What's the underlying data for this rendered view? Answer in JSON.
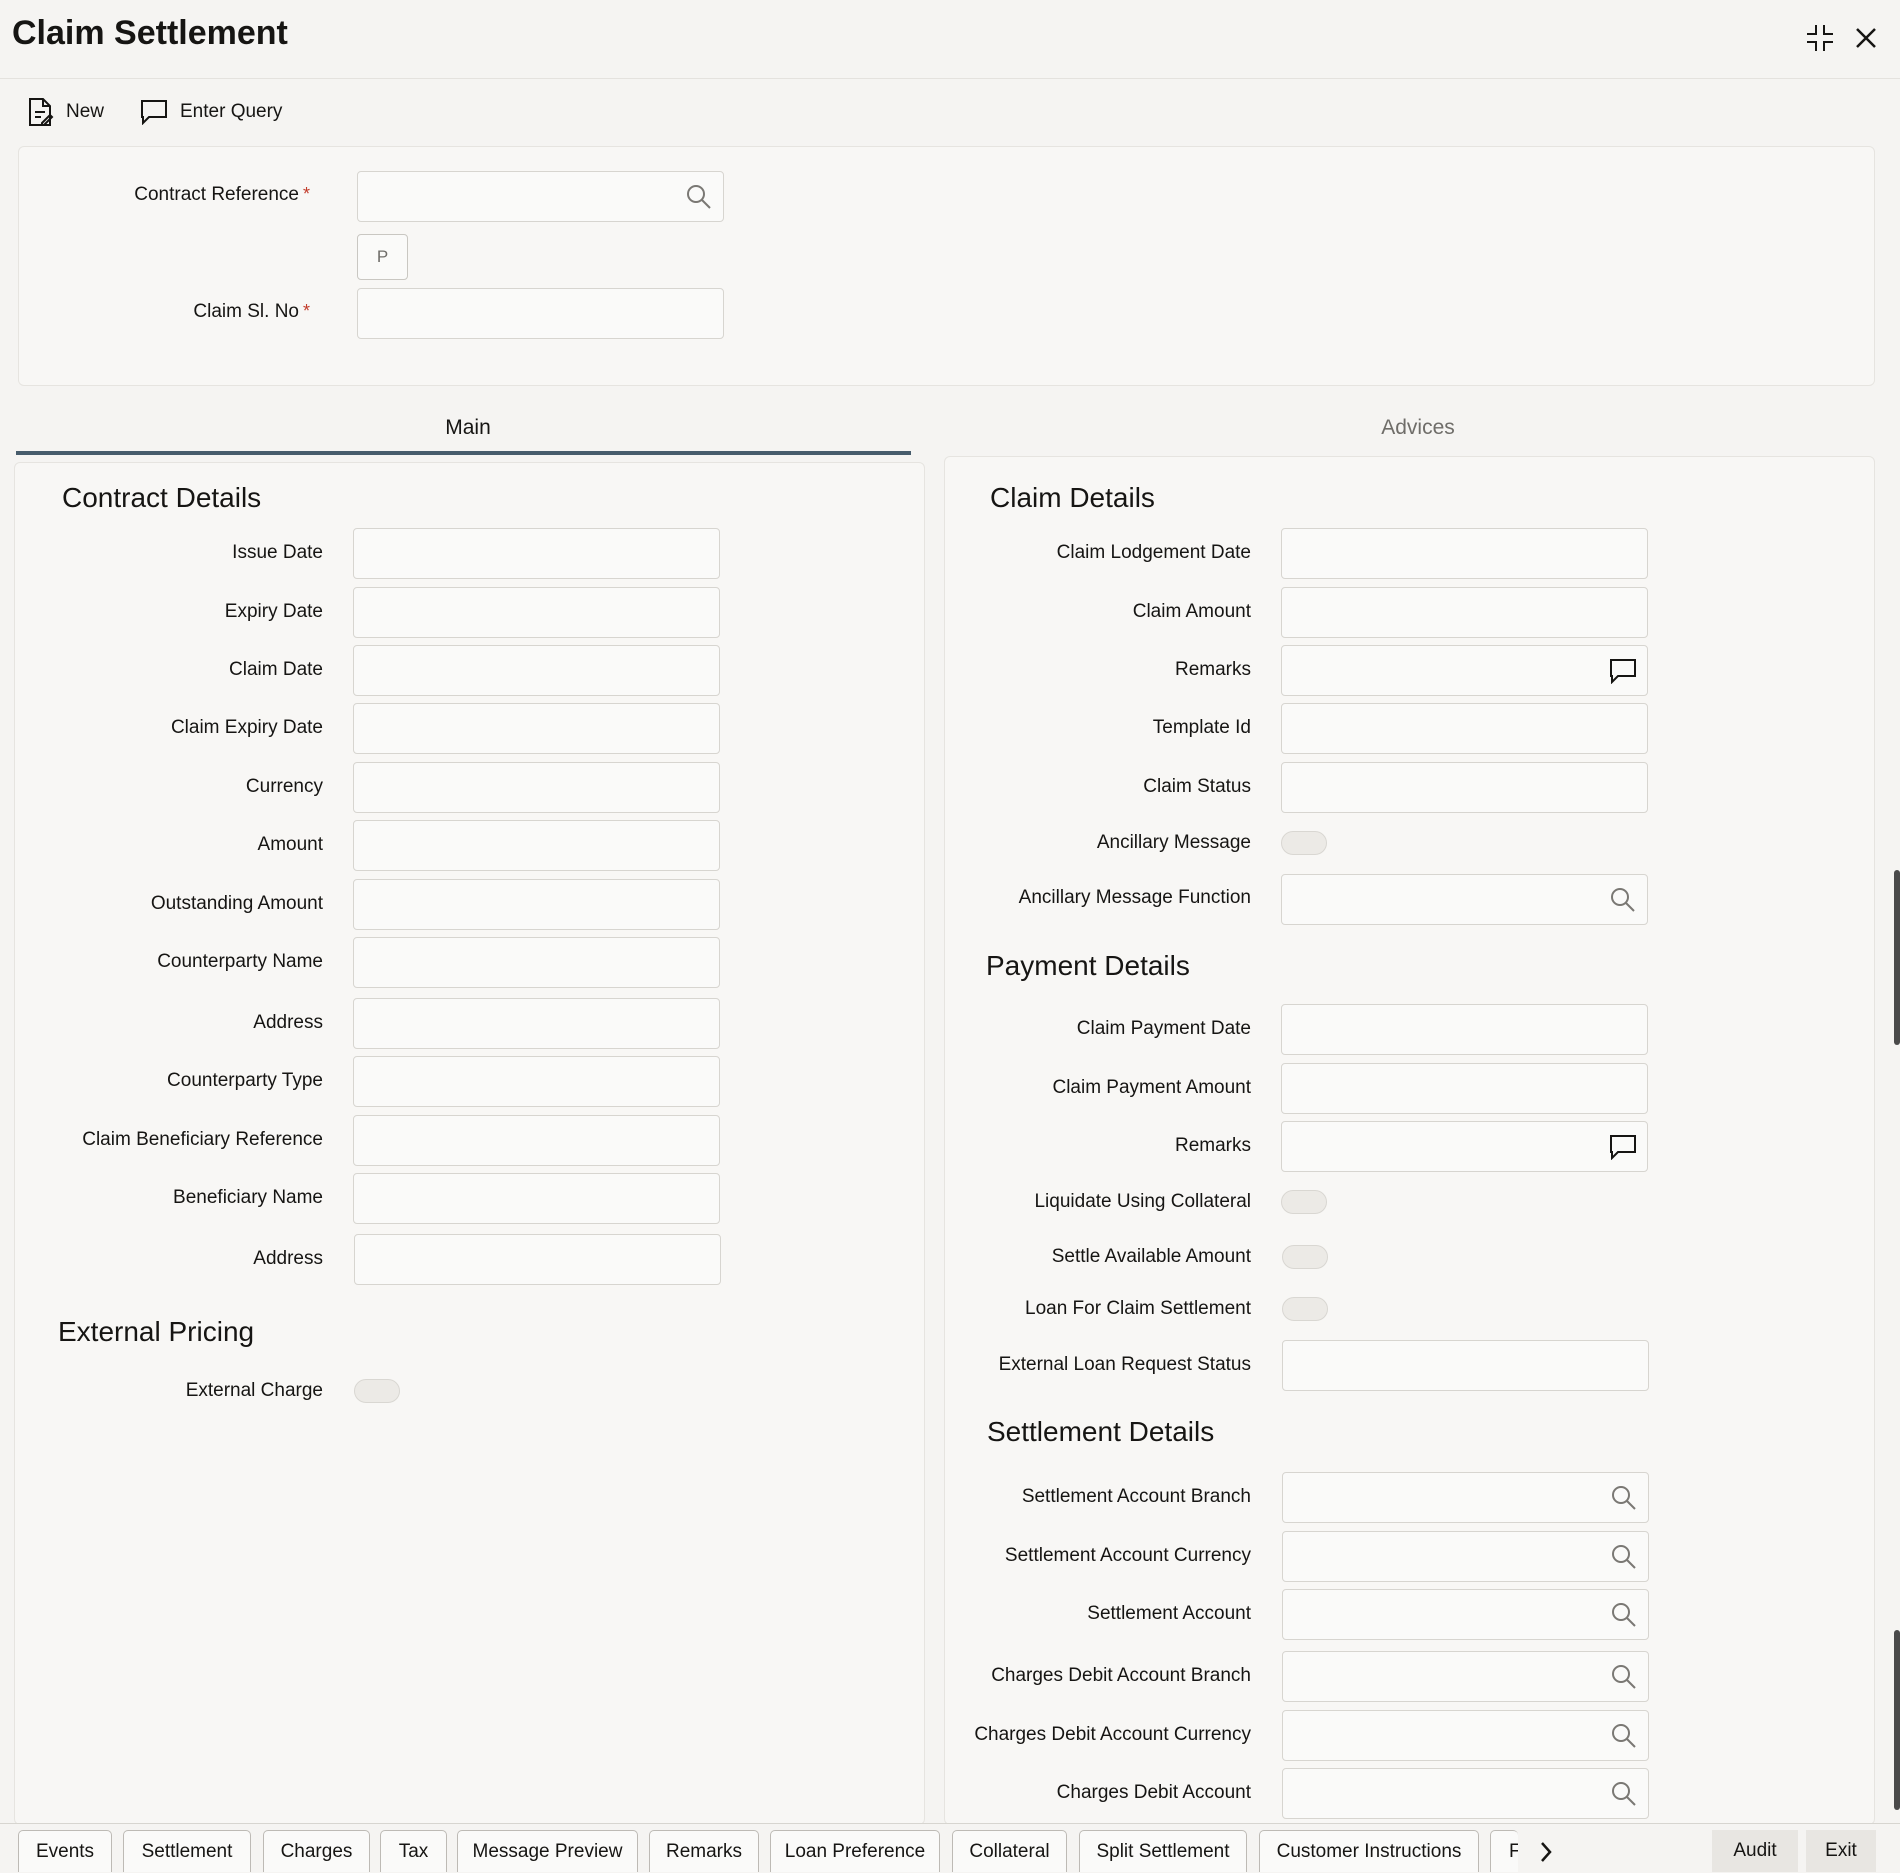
{
  "window": {
    "title": "Claim Settlement"
  },
  "toolbar": {
    "new_label": "New",
    "enter_query_label": "Enter Query"
  },
  "query": {
    "contract_reference_label": "Contract Reference",
    "required_mark": "*",
    "p_button_label": "P",
    "claim_sl_no_label": "Claim Sl. No"
  },
  "tabs": {
    "main": "Main",
    "advices": "Advices"
  },
  "contract_details": {
    "title": "Contract Details",
    "fields": [
      "Issue Date",
      "Expiry Date",
      "Claim Date",
      "Claim Expiry Date",
      "Currency",
      "Amount",
      "Outstanding Amount",
      "Counterparty Name",
      "Address",
      "Counterparty Type",
      "Claim Beneficiary Reference",
      "Beneficiary Name",
      "Address"
    ]
  },
  "external_pricing": {
    "title": "External Pricing",
    "external_charge_label": "External Charge"
  },
  "claim_details": {
    "title": "Claim Details",
    "claim_lodgement_date": "Claim Lodgement Date",
    "claim_amount": "Claim Amount",
    "remarks": "Remarks",
    "template_id": "Template Id",
    "claim_status": "Claim Status",
    "ancillary_message": "Ancillary Message",
    "ancillary_message_function": "Ancillary Message Function"
  },
  "payment_details": {
    "title": "Payment Details",
    "claim_payment_date": "Claim Payment Date",
    "claim_payment_amount": "Claim Payment Amount",
    "remarks": "Remarks",
    "liquidate_using_collateral": "Liquidate Using Collateral",
    "settle_available_amount": "Settle Available Amount",
    "loan_for_claim_settlement": "Loan For Claim Settlement",
    "external_loan_request_status": "External Loan Request Status"
  },
  "settlement_details": {
    "title": "Settlement Details",
    "fields": [
      "Settlement Account Branch",
      "Settlement Account Currency",
      "Settlement Account",
      "Charges Debit Account Branch",
      "Charges Debit Account Currency",
      "Charges Debit Account"
    ]
  },
  "bottom_tabs": [
    "Events",
    "Settlement",
    "Charges",
    "Tax",
    "Message Preview",
    "Remarks",
    "Loan Preference",
    "Collateral",
    "Split Settlement",
    "Customer Instructions",
    "F"
  ],
  "bottom_buttons": {
    "audit": "Audit",
    "exit": "Exit"
  }
}
